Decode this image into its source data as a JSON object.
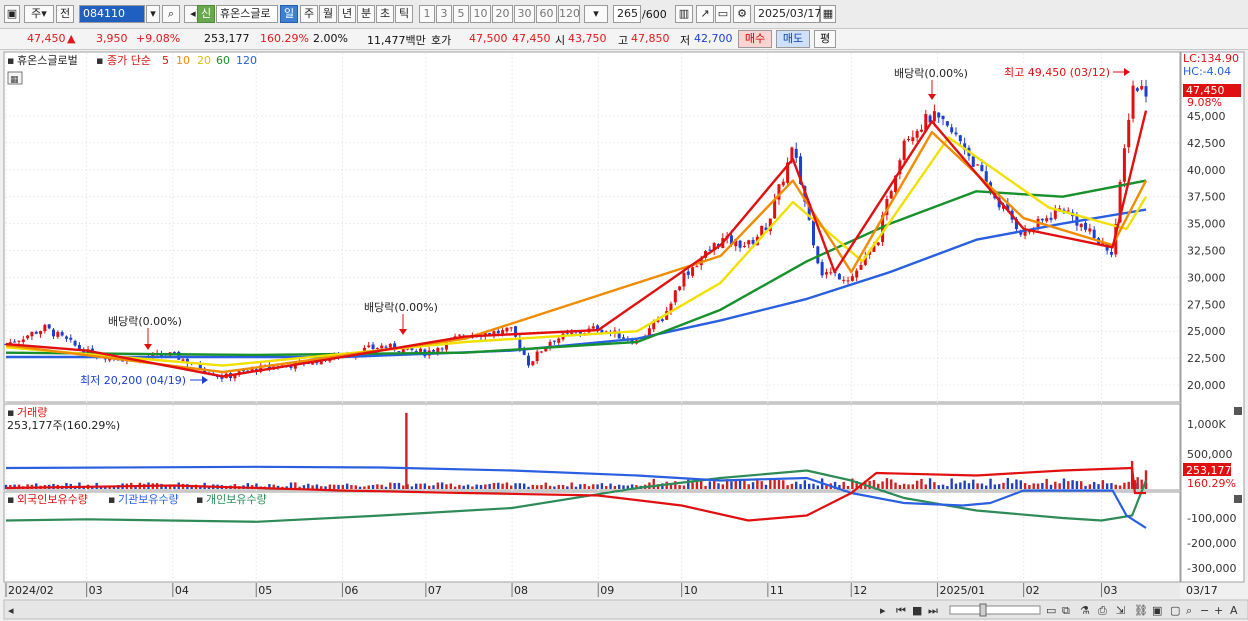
{
  "toolbar": {
    "period_tabs": [
      "주",
      "전"
    ],
    "code": "084110",
    "new_badge": "신",
    "stock_name": "휴온스글로",
    "active_period": "일",
    "periods": [
      "주",
      "월",
      "년",
      "분",
      "초",
      "틱"
    ],
    "interval_buttons": [
      "1",
      "3",
      "5",
      "10",
      "20",
      "30",
      "60",
      "120"
    ],
    "count": "265",
    "count_total": "/600",
    "date": "2025/03/17"
  },
  "quote": {
    "price": "47,450",
    "arrow": "▲",
    "change": "3,950",
    "change_pct": "+9.08%",
    "volume": "253,177",
    "volume_ratio": "160.29%",
    "turnover": "2.00%",
    "amount": "11,477백만",
    "ask_label": "호가",
    "ask": "47,500",
    "bid": "47,450",
    "open_label": "시",
    "open": "43,750",
    "high_label": "고",
    "high": "47,850",
    "low_label": "저",
    "low": "42,700",
    "buy_button": "매수",
    "sell_button": "매도",
    "eval_button": "평"
  },
  "price_panel": {
    "legend_name": "휴온스글로벌",
    "legend_type": "종가 단순",
    "ma_labels": [
      "5",
      "10",
      "20",
      "60",
      "120"
    ],
    "ma_colors": [
      "#e01010",
      "#f08c00",
      "#f2e000",
      "#18902c",
      "#2a5fe0"
    ],
    "right_top": [
      "LC:134.90",
      "HC:-4.04"
    ],
    "current_price_label": "47,450",
    "current_pct_label": "9.08%",
    "annotations": [
      {
        "text": "배당락(0.00%)",
        "date": "2024-04-01"
      },
      {
        "text": "배당락(0.00%)",
        "date": "2024-06-26"
      },
      {
        "text": "배당락(0.00%)",
        "date": "2024-12-30"
      }
    ],
    "low_annotation": {
      "text": "최저 20,200 (04/19)",
      "value": 20200
    },
    "high_annotation": {
      "text": "최고 49,450 (03/12)",
      "value": 49450
    }
  },
  "volume_panel": {
    "title": "거래량",
    "value_label": "253,177주(160.29%)",
    "axis_ticks": [
      "1,000K",
      "500,000"
    ],
    "current_label": "253,177",
    "current_pct": "160.29%"
  },
  "holdings_panel": {
    "legend": [
      "외국인보유수량",
      "기관보유수량",
      "개인보유수량"
    ],
    "colors": [
      "#e01010",
      "#2a5fe0",
      "#2e8b57"
    ],
    "axis_ticks": [
      "-100,000",
      "-200,000",
      "-300,000"
    ]
  },
  "x_axis": {
    "labels": [
      "2024/02",
      "03",
      "04",
      "05",
      "06",
      "07",
      "08",
      "09",
      "10",
      "11",
      "12",
      "2025/01",
      "02",
      "03"
    ],
    "right_label": "03/17"
  },
  "chart_data": {
    "type": "candlestick",
    "x": [
      "2024-02",
      "2024-03",
      "2024-04",
      "2024-05",
      "2024-06",
      "2024-07",
      "2024-08",
      "2024-09",
      "2024-10",
      "2024-11",
      "2024-12",
      "2025-01",
      "2025-02",
      "2025-03"
    ],
    "close_path": [
      [
        "2024-02-01",
        23800
      ],
      [
        "2024-02-15",
        25300
      ],
      [
        "2024-03-01",
        23000
      ],
      [
        "2024-03-15",
        22400
      ],
      [
        "2024-04-01",
        22800
      ],
      [
        "2024-04-19",
        20700
      ],
      [
        "2024-05-01",
        21500
      ],
      [
        "2024-05-15",
        21900
      ],
      [
        "2024-06-01",
        22800
      ],
      [
        "2024-06-15",
        23600
      ],
      [
        "2024-07-01",
        23000
      ],
      [
        "2024-07-15",
        24700
      ],
      [
        "2024-08-01",
        25000
      ],
      [
        "2024-08-07",
        22000
      ],
      [
        "2024-08-15",
        24200
      ],
      [
        "2024-09-01",
        25300
      ],
      [
        "2024-09-15",
        24000
      ],
      [
        "2024-09-25",
        26500
      ],
      [
        "2024-10-01",
        30000
      ],
      [
        "2024-10-15",
        33500
      ],
      [
        "2024-10-25",
        33000
      ],
      [
        "2024-11-01",
        35000
      ],
      [
        "2024-11-10",
        42000
      ],
      [
        "2024-11-20",
        30500
      ],
      [
        "2024-12-01",
        30000
      ],
      [
        "2024-12-10",
        33000
      ],
      [
        "2024-12-20",
        43000
      ],
      [
        "2024-12-30",
        45000
      ],
      [
        "2025-01-10",
        42500
      ],
      [
        "2025-01-20",
        38000
      ],
      [
        "2025-02-01",
        34000
      ],
      [
        "2025-02-15",
        36500
      ],
      [
        "2025-03-01",
        33000
      ],
      [
        "2025-03-05",
        32500
      ],
      [
        "2025-03-12",
        47800
      ],
      [
        "2025-03-17",
        47450
      ]
    ],
    "moving_averages": {
      "ma5": [
        [
          "2024-02-01",
          23800
        ],
        [
          "2024-03-01",
          23200
        ],
        [
          "2024-04-19",
          20800
        ],
        [
          "2024-06-01",
          22600
        ],
        [
          "2024-07-15",
          24500
        ],
        [
          "2024-09-01",
          25100
        ],
        [
          "2024-10-15",
          33000
        ],
        [
          "2024-11-10",
          41000
        ],
        [
          "2024-11-25",
          30500
        ],
        [
          "2024-12-30",
          44500
        ],
        [
          "2025-02-01",
          34500
        ],
        [
          "2025-03-05",
          32800
        ],
        [
          "2025-03-17",
          45500
        ]
      ],
      "ma10": [
        [
          "2024-02-01",
          23700
        ],
        [
          "2024-04-19",
          21200
        ],
        [
          "2024-07-15",
          24300
        ],
        [
          "2024-10-15",
          32000
        ],
        [
          "2024-11-10",
          39000
        ],
        [
          "2024-12-01",
          30500
        ],
        [
          "2024-12-30",
          43500
        ],
        [
          "2025-02-01",
          35500
        ],
        [
          "2025-03-05",
          33000
        ],
        [
          "2025-03-17",
          39000
        ]
      ],
      "ma20": [
        [
          "2024-02-01",
          23500
        ],
        [
          "2024-04-19",
          21800
        ],
        [
          "2024-07-15",
          24000
        ],
        [
          "2024-09-15",
          25000
        ],
        [
          "2024-10-15",
          29500
        ],
        [
          "2024-11-10",
          37000
        ],
        [
          "2024-12-05",
          31500
        ],
        [
          "2025-01-05",
          43000
        ],
        [
          "2025-02-10",
          36500
        ],
        [
          "2025-03-10",
          34500
        ],
        [
          "2025-03-17",
          37500
        ]
      ],
      "ma60": [
        [
          "2024-02-01",
          23000
        ],
        [
          "2024-05-01",
          22800
        ],
        [
          "2024-07-15",
          23000
        ],
        [
          "2024-09-15",
          24000
        ],
        [
          "2024-10-15",
          27000
        ],
        [
          "2024-11-15",
          31500
        ],
        [
          "2024-12-15",
          35000
        ],
        [
          "2025-01-15",
          38000
        ],
        [
          "2025-02-15",
          37500
        ],
        [
          "2025-03-17",
          39000
        ]
      ],
      "ma120": [
        [
          "2024-02-01",
          22600
        ],
        [
          "2024-06-01",
          22600
        ],
        [
          "2024-08-01",
          23200
        ],
        [
          "2024-09-15",
          24300
        ],
        [
          "2024-10-15",
          26000
        ],
        [
          "2024-11-15",
          28000
        ],
        [
          "2024-12-15",
          30500
        ],
        [
          "2025-01-15",
          33500
        ],
        [
          "2025-02-15",
          35000
        ],
        [
          "2025-03-17",
          36300
        ]
      ]
    },
    "y_ticks": [
      20000,
      22500,
      25000,
      27500,
      30000,
      32500,
      35000,
      37500,
      40000,
      42500,
      45000
    ],
    "ylim": [
      18500,
      50000
    ],
    "volume": {
      "ylim": [
        0,
        1150000
      ],
      "spike": {
        "date": "2024-06-24",
        "value": 1030000
      },
      "recent": [
        [
          "2025-03-12",
          380000
        ],
        [
          "2025-03-13",
          120000
        ],
        [
          "2025-03-14",
          160000
        ],
        [
          "2025-03-17",
          253177
        ]
      ]
    },
    "holdings": {
      "ylim": [
        -320000,
        -60000
      ],
      "foreign": [
        [
          "2024-02-01",
          -220000
        ],
        [
          "2024-04-01",
          -230000
        ],
        [
          "2024-06-01",
          -210000
        ],
        [
          "2024-07-15",
          -200000
        ],
        [
          "2024-09-01",
          -190000
        ],
        [
          "2024-10-01",
          -150000
        ],
        [
          "2024-10-25",
          -90000
        ],
        [
          "2024-11-15",
          -110000
        ],
        [
          "2024-12-01",
          -200000
        ],
        [
          "2024-12-10",
          -280000
        ],
        [
          "2025-01-15",
          -270000
        ],
        [
          "2025-02-15",
          -290000
        ],
        [
          "2025-03-12",
          -300000
        ],
        [
          "2025-03-13",
          -200000
        ],
        [
          "2025-03-17",
          -200000
        ]
      ],
      "institution": [
        [
          "2024-02-01",
          -300000
        ],
        [
          "2024-05-01",
          -305000
        ],
        [
          "2024-06-15",
          -302000
        ],
        [
          "2024-08-01",
          -290000
        ],
        [
          "2024-09-15",
          -270000
        ],
        [
          "2024-10-15",
          -250000
        ],
        [
          "2024-11-15",
          -260000
        ],
        [
          "2024-12-01",
          -200000
        ],
        [
          "2024-12-20",
          -160000
        ],
        [
          "2025-01-10",
          -150000
        ],
        [
          "2025-01-20",
          -160000
        ],
        [
          "2025-02-01",
          -210000
        ],
        [
          "2025-03-05",
          -210000
        ],
        [
          "2025-03-10",
          -110000
        ],
        [
          "2025-03-17",
          -60000
        ]
      ],
      "individual": [
        [
          "2024-02-01",
          -90000
        ],
        [
          "2024-03-01",
          -95000
        ],
        [
          "2024-05-01",
          -85000
        ],
        [
          "2024-06-15",
          -110000
        ],
        [
          "2024-08-01",
          -140000
        ],
        [
          "2024-09-15",
          -220000
        ],
        [
          "2024-10-15",
          -260000
        ],
        [
          "2024-11-15",
          -290000
        ],
        [
          "2024-12-01",
          -250000
        ],
        [
          "2024-12-20",
          -180000
        ],
        [
          "2025-01-15",
          -130000
        ],
        [
          "2025-02-15",
          -100000
        ],
        [
          "2025-03-01",
          -90000
        ],
        [
          "2025-03-12",
          -110000
        ],
        [
          "2025-03-17",
          -250000
        ]
      ]
    }
  }
}
